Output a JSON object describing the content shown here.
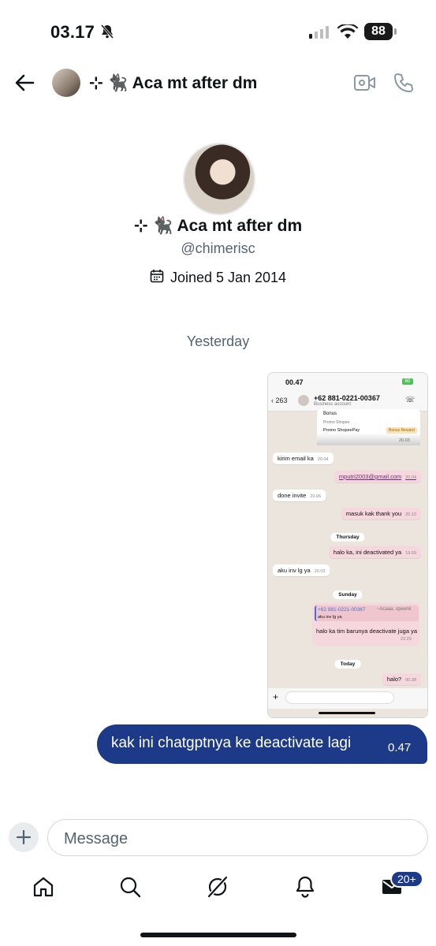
{
  "status_bar": {
    "time": "03.17",
    "battery": "88"
  },
  "header": {
    "title": "⊹ 🐈‍⬛ Aca mt after dm"
  },
  "profile": {
    "name": "⊹ 🐈‍⬛ Aca mt after dm",
    "handle": "@chimerisc",
    "joined": "Joined 5 Jan 2014"
  },
  "conversation": {
    "day_separator": "Yesterday",
    "screenshot": {
      "status_time": "00.47",
      "battery": "60",
      "back_count": "263",
      "contact": "+62 881-0221-00367",
      "contact_sub": "Business account",
      "card": {
        "title": "Bonus",
        "line1": "Promo Shopee",
        "line2": "Promo ShopeePay",
        "tag": "Bonus Reward",
        "time": "20.03"
      },
      "messages": [
        {
          "text": "kirim email ka",
          "time": "20.04",
          "dir": "in"
        },
        {
          "text": "mputri2003@gmail.com",
          "time": "20.04",
          "dir": "out"
        },
        {
          "text": "done invite",
          "time": "20.06",
          "dir": "in"
        },
        {
          "text": "masuk kak thank you",
          "time": "20.10",
          "dir": "out"
        },
        {
          "text": "halo ka, ini deactivated ya",
          "time": "19.59",
          "dir": "out"
        },
        {
          "text": "aku inv lg ya",
          "time": "20.03",
          "dir": "in"
        },
        {
          "text": "halo?",
          "time": "00.38",
          "dir": "out"
        }
      ],
      "day_pills": [
        "Thursday",
        "Sunday",
        "Today"
      ],
      "quote": {
        "name": "+62 881-0221-00367",
        "alias": "~Acaaa, opeenk",
        "quoted_text": "aku inv lg ya",
        "text": "halo ka tim barunya deactivate juga ya",
        "time": "23.29"
      }
    },
    "sent_message": {
      "text": "kak ini chatgptnya ke deactivate lagi",
      "time": "0.47"
    }
  },
  "composer": {
    "placeholder": "Message"
  },
  "nav": {
    "badge": "20+"
  },
  "colors": {
    "accent": "#1d3a88",
    "secondary_text": "#536471"
  }
}
